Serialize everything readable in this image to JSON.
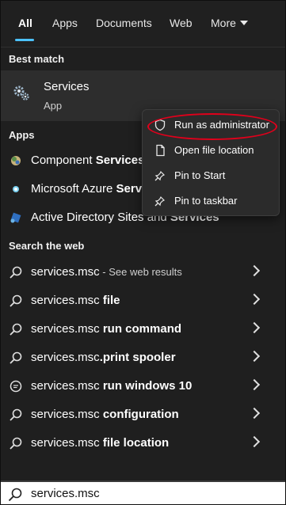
{
  "tabs": [
    {
      "label": "All"
    },
    {
      "label": "Apps"
    },
    {
      "label": "Documents"
    },
    {
      "label": "Web"
    },
    {
      "label": "More"
    }
  ],
  "sections": {
    "best_match": "Best match",
    "apps": "Apps",
    "search_web": "Search the web"
  },
  "best_match": {
    "title": "Services",
    "subtitle": "App",
    "icon": "services-gear-icon"
  },
  "apps": [
    {
      "prefix": "Component ",
      "bold": "Services",
      "suffix": "",
      "icon": "component-services-icon"
    },
    {
      "prefix": "Microsoft Azure ",
      "bold": "Serv",
      "suffix": "",
      "icon": "azure-icon"
    },
    {
      "prefix": "Active Directory Sites and ",
      "bold": "Services",
      "suffix": "",
      "icon": "active-directory-icon"
    }
  ],
  "web_results": [
    {
      "prefix": "services.msc",
      "bold": "",
      "muted": " - See web results",
      "icon": "search-icon"
    },
    {
      "prefix": "services.msc ",
      "bold": "file",
      "muted": "",
      "icon": "search-icon"
    },
    {
      "prefix": "services.msc ",
      "bold": "run command",
      "muted": "",
      "icon": "search-icon"
    },
    {
      "prefix": "services.msc",
      "bold": ".print spooler",
      "muted": "",
      "icon": "search-icon"
    },
    {
      "prefix": "services.msc ",
      "bold": "run windows 10",
      "muted": "",
      "icon": "chat-icon"
    },
    {
      "prefix": "services.msc ",
      "bold": "configuration",
      "muted": "",
      "icon": "search-icon"
    },
    {
      "prefix": "services.msc ",
      "bold": "file location",
      "muted": "",
      "icon": "search-icon"
    }
  ],
  "context_menu": [
    {
      "label": "Run as administrator",
      "icon": "shield-icon"
    },
    {
      "label": "Open file location",
      "icon": "file-icon"
    },
    {
      "label": "Pin to Start",
      "icon": "pin-icon"
    },
    {
      "label": "Pin to taskbar",
      "icon": "pin-icon"
    }
  ],
  "search": {
    "value": "services.msc"
  },
  "colors": {
    "background": "#202020",
    "highlight": "#2d2d2d",
    "accent": "#4cc2ff",
    "annotation": "#e0001b"
  }
}
